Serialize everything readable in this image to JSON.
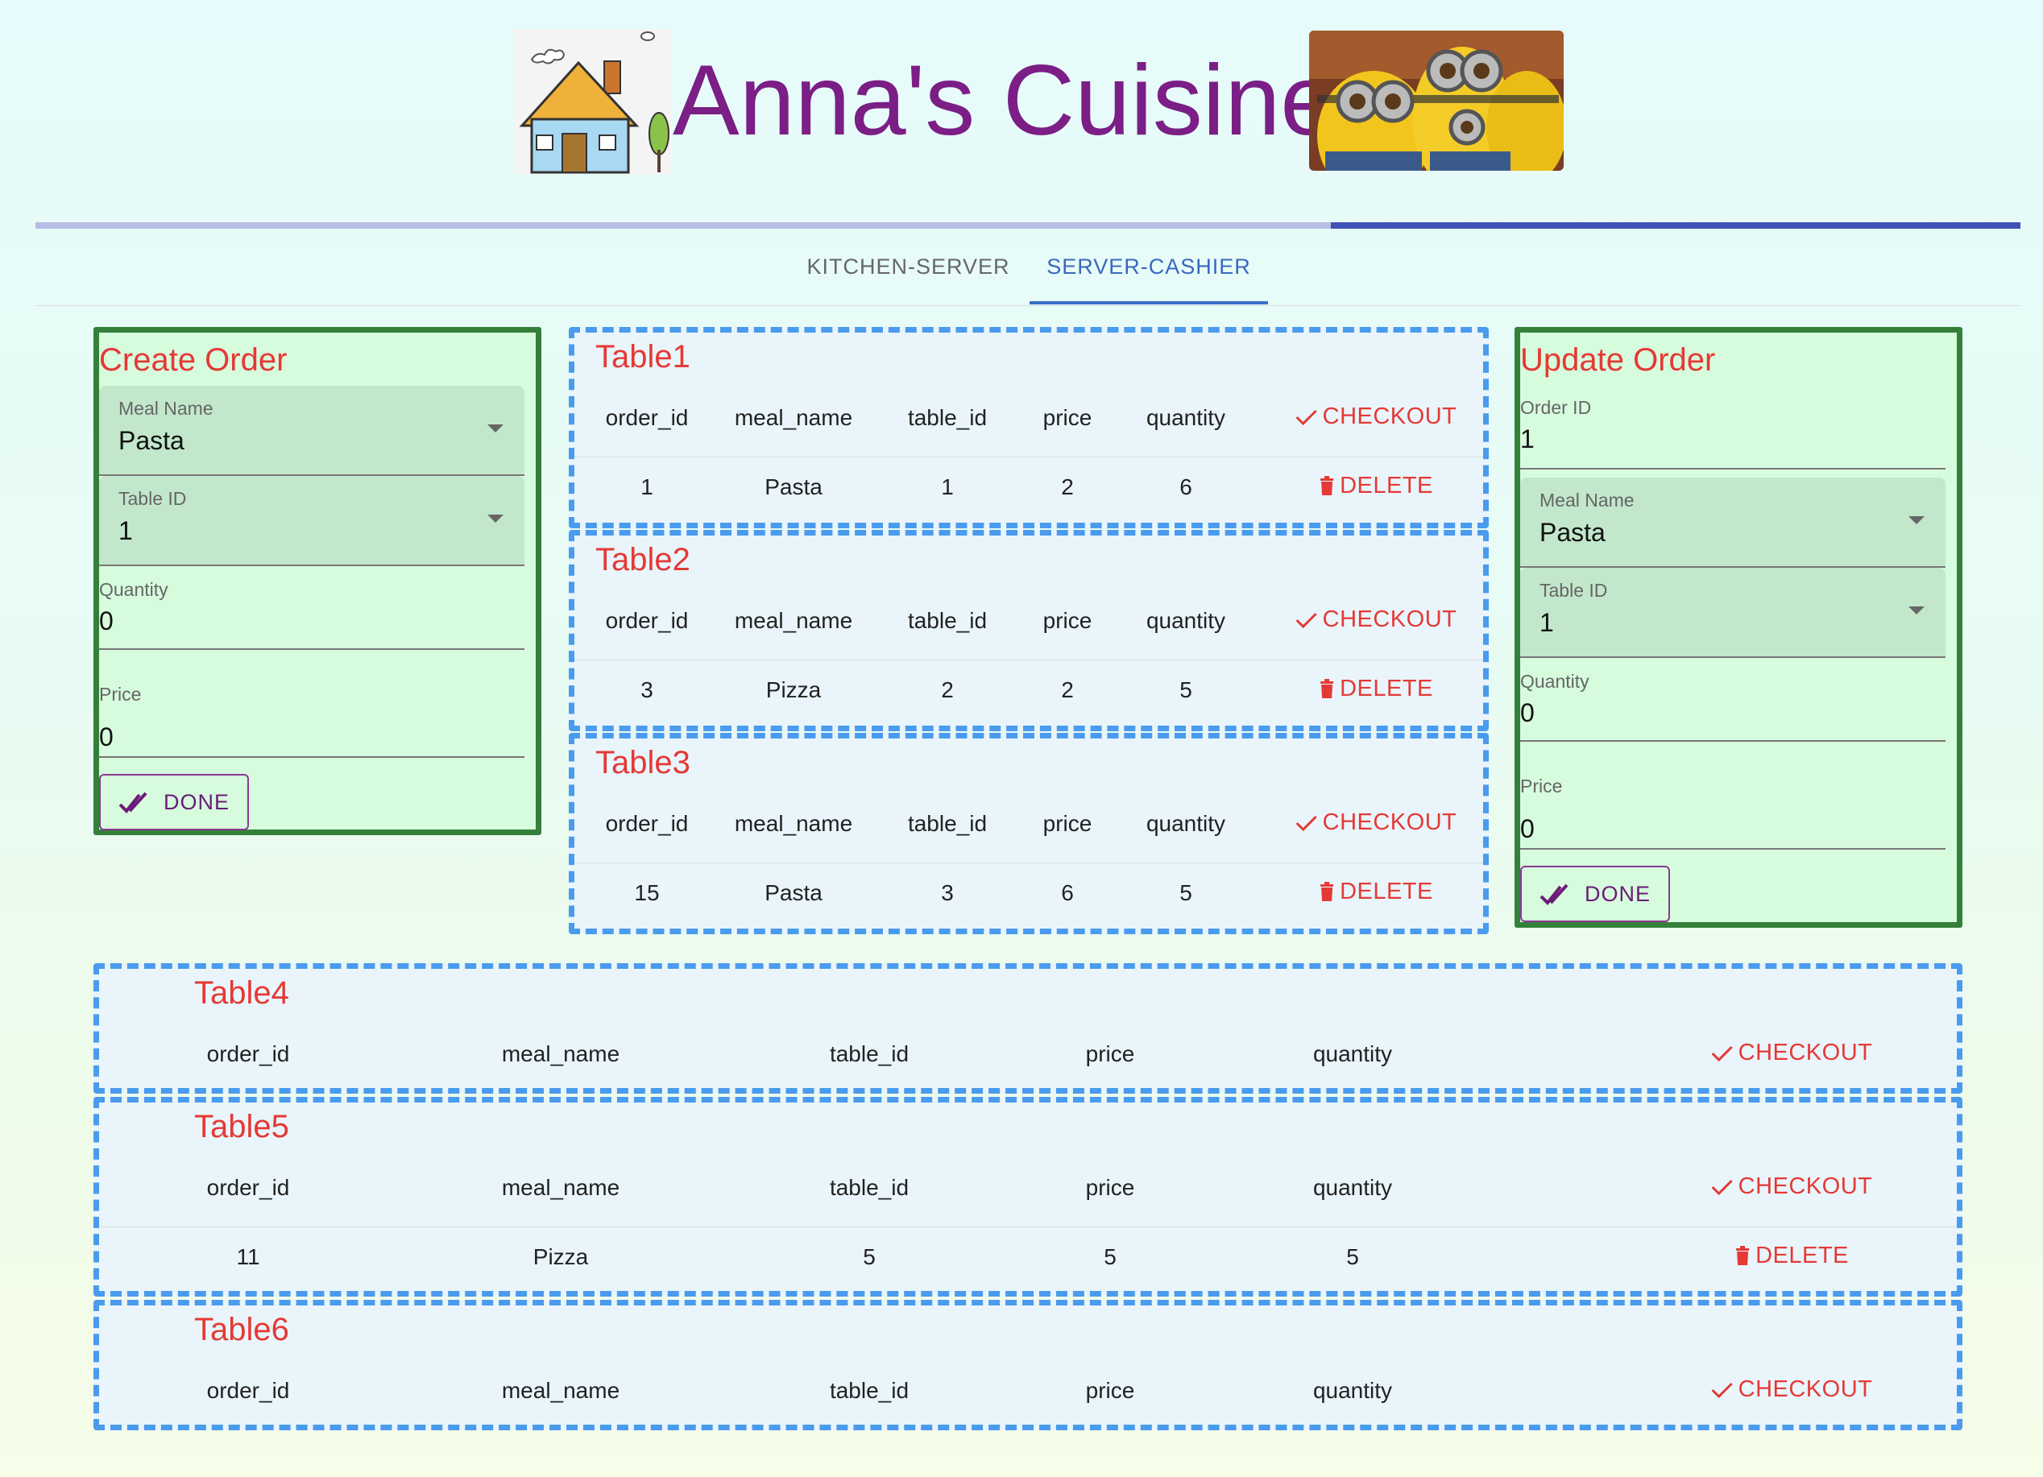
{
  "header": {
    "title": "Anna's Cuisine"
  },
  "tabs": [
    {
      "label": "KITCHEN-SERVER"
    },
    {
      "label": "SERVER-CASHIER"
    }
  ],
  "create_order": {
    "title": "Create Order",
    "meal_name_label": "Meal Name",
    "meal_name_value": "Pasta",
    "table_id_label": "Table ID",
    "table_id_value": "1",
    "quantity_label": "Quantity",
    "quantity_value": "0",
    "price_label": "Price",
    "price_value": "0",
    "done_label": "DONE"
  },
  "update_order": {
    "title": "Update Order",
    "order_id_label": "Order ID",
    "order_id_value": "1",
    "meal_name_label": "Meal Name",
    "meal_name_value": "Pasta",
    "table_id_label": "Table ID",
    "table_id_value": "1",
    "quantity_label": "Quantity",
    "quantity_value": "0",
    "price_label": "Price",
    "price_value": "0",
    "done_label": "DONE"
  },
  "columns": [
    "order_id",
    "meal_name",
    "table_id",
    "price",
    "quantity"
  ],
  "checkout_label": "CHECKOUT",
  "delete_label": "DELETE",
  "tables": [
    {
      "name": "Table1",
      "rows": [
        {
          "order_id": "1",
          "meal_name": "Pasta",
          "table_id": "1",
          "price": "2",
          "quantity": "6"
        }
      ]
    },
    {
      "name": "Table2",
      "rows": [
        {
          "order_id": "3",
          "meal_name": "Pizza",
          "table_id": "2",
          "price": "2",
          "quantity": "5"
        }
      ]
    },
    {
      "name": "Table3",
      "rows": [
        {
          "order_id": "15",
          "meal_name": "Pasta",
          "table_id": "3",
          "price": "6",
          "quantity": "5"
        }
      ]
    },
    {
      "name": "Table4",
      "rows": []
    },
    {
      "name": "Table5",
      "rows": [
        {
          "order_id": "11",
          "meal_name": "Pizza",
          "table_id": "5",
          "price": "5",
          "quantity": "5"
        }
      ]
    },
    {
      "name": "Table6",
      "rows": []
    }
  ],
  "colors": {
    "title": "#7b1e85",
    "accent_red": "#e53935",
    "panel_border": "#34803a",
    "table_border": "#4a9bee",
    "tab_active": "#3a68c0"
  },
  "icons": {
    "checkout": "check-icon",
    "delete": "trash-icon",
    "done": "double-check-icon"
  }
}
